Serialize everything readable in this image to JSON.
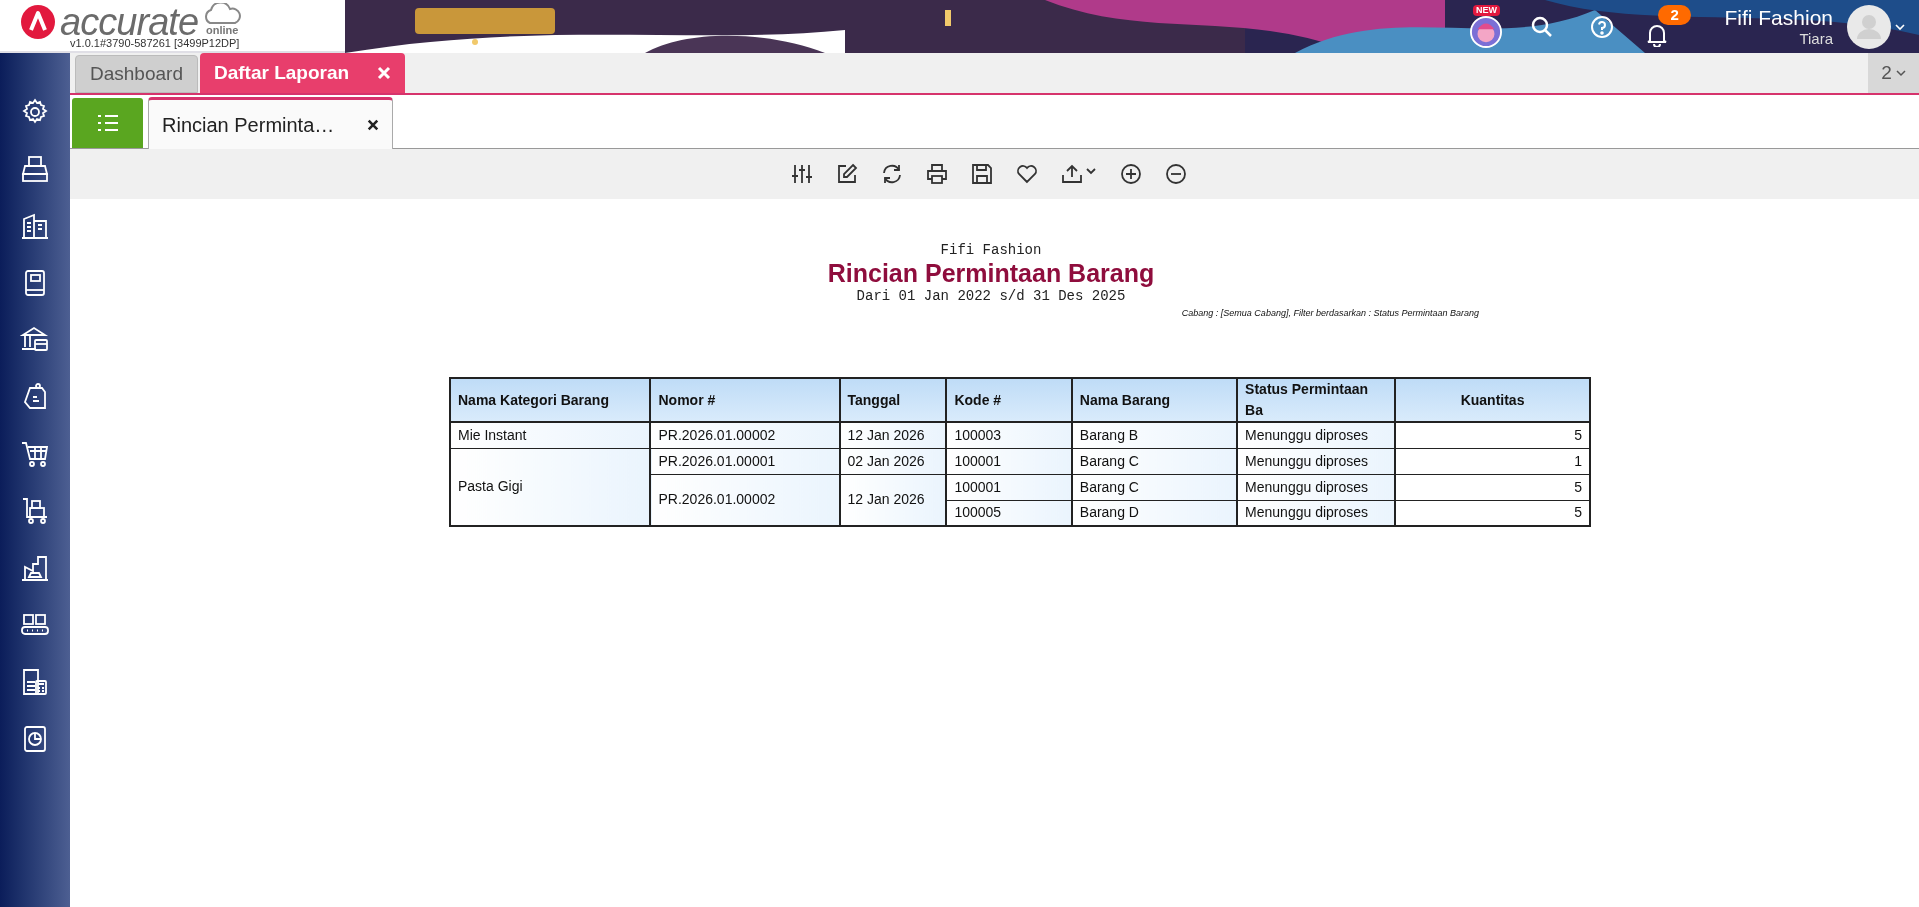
{
  "header": {
    "brand": "accurate",
    "brand_suffix": "online",
    "version": "v1.0.1#3790-587261 [3499P12DP]",
    "new_badge": "NEW",
    "notification_count": "2",
    "company": "Fifi Fashion",
    "user": "Tiara"
  },
  "tabs": [
    {
      "label": "Dashboard",
      "selected": false
    },
    {
      "label": "Daftar Laporan",
      "selected": true
    }
  ],
  "tab_overflow": "2",
  "subtabs": [
    {
      "label": "Rincian Perminta…",
      "selected": true
    }
  ],
  "report": {
    "company": "Fifi Fashion",
    "title": "Rincian Permintaan Barang",
    "period": "Dari 01 Jan 2022 s/d 31 Des 2025",
    "filter": "Cabang : [Semua Cabang], Filter berdasarkan : Status Permintaan Barang",
    "columns": [
      "Nama Kategori Barang",
      "Nomor #",
      "Tanggal",
      "Kode #",
      "Nama Barang",
      "Status Permintaan Ba",
      "Kuantitas"
    ],
    "groups": [
      {
        "category": "Mie Instant",
        "entries": [
          {
            "nomor": "PR.2026.01.00002",
            "tanggal": "12 Jan 2026",
            "items": [
              {
                "kode": "100003",
                "nama": "Barang B",
                "status": "Menunggu diproses",
                "qty": "5"
              }
            ]
          }
        ]
      },
      {
        "category": "Pasta Gigi",
        "entries": [
          {
            "nomor": "PR.2026.01.00001",
            "tanggal": "02 Jan 2026",
            "items": [
              {
                "kode": "100001",
                "nama": "Barang C",
                "status": "Menunggu diproses",
                "qty": "1"
              }
            ]
          },
          {
            "nomor": "PR.2026.01.00002",
            "tanggal": "12 Jan 2026",
            "items": [
              {
                "kode": "100001",
                "nama": "Barang C",
                "status": "Menunggu diproses",
                "qty": "5"
              },
              {
                "kode": "100005",
                "nama": "Barang D",
                "status": "Menunggu diproses",
                "qty": "5"
              }
            ]
          }
        ]
      }
    ]
  }
}
